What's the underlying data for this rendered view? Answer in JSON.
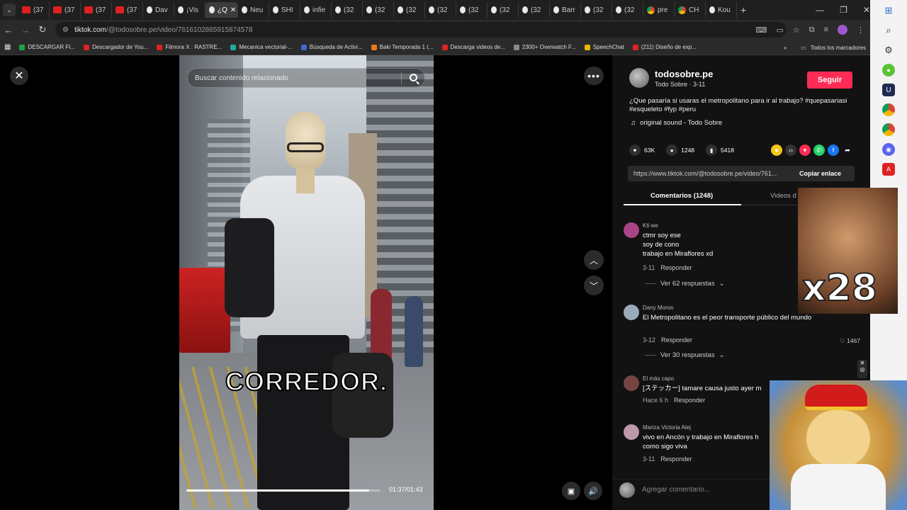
{
  "browser": {
    "tabs": [
      {
        "label": "(37",
        "icon": "youtube-icon"
      },
      {
        "label": "(37",
        "icon": "youtube-icon"
      },
      {
        "label": "(37",
        "icon": "youtube-icon"
      },
      {
        "label": "(37",
        "icon": "youtube-icon"
      },
      {
        "label": "Dav",
        "icon": "tiktok-icon"
      },
      {
        "label": "¡Vis",
        "icon": "tiktok-icon"
      },
      {
        "label": "¿Q",
        "icon": "tiktok-icon",
        "active": true
      },
      {
        "label": "Neu",
        "icon": "tiktok-icon"
      },
      {
        "label": "SHI",
        "icon": "tiktok-icon"
      },
      {
        "label": "infie",
        "icon": "tiktok-icon"
      },
      {
        "label": "(32",
        "icon": "tiktok-icon"
      },
      {
        "label": "(32",
        "icon": "tiktok-icon"
      },
      {
        "label": "(32",
        "icon": "tiktok-icon"
      },
      {
        "label": "(32",
        "icon": "tiktok-icon"
      },
      {
        "label": "(32",
        "icon": "tiktok-icon"
      },
      {
        "label": "(32",
        "icon": "tiktok-icon"
      },
      {
        "label": "(32",
        "icon": "tiktok-icon"
      },
      {
        "label": "Barr",
        "icon": "tiktok-icon"
      },
      {
        "label": "(32",
        "icon": "tiktok-icon"
      },
      {
        "label": "(32",
        "icon": "tiktok-icon"
      },
      {
        "label": "pre",
        "icon": "chrome-icon"
      },
      {
        "label": "CH",
        "icon": "chrome-icon"
      },
      {
        "label": "Kou",
        "icon": "tiktok-icon"
      }
    ],
    "url_host": "tiktok.com",
    "url_path": "/@todosobre.pe/video/7616102865915874578",
    "bookmarks": [
      {
        "label": "DESCARGAR FI...",
        "color": "#1aa34a"
      },
      {
        "label": "Descargador de You...",
        "color": "#d22"
      },
      {
        "label": "Filmora X : RASTRE...",
        "color": "#d22"
      },
      {
        "label": "Mecanica vectorial-...",
        "color": "#2a9"
      },
      {
        "label": "Búsqueda de Activi...",
        "color": "#46c"
      },
      {
        "label": "Baki Temporada 1 (...",
        "color": "#e87a1a"
      },
      {
        "label": "Descarga videos de...",
        "color": "#d22"
      },
      {
        "label": "2300+ Overwatch F...",
        "color": "#888"
      },
      {
        "label": "SpeechChat",
        "color": "#e6b800"
      },
      {
        "label": "(211) Diseño de exp...",
        "color": "#d22"
      }
    ],
    "all_bookmarks": "Todos los marcadores"
  },
  "video": {
    "search_placeholder": "Buscar contenido relacionado",
    "caption": "CORREDOR.",
    "time": "01:37/01:43",
    "progress": 0.94
  },
  "panel": {
    "author_name": "todosobre.pe",
    "author_sub": "Todo Sobre · 3-11",
    "follow": "Seguir",
    "description": "¿Que pasaría si usaras el metropolitano para ir al trabajo? #quepasariasi #esqueleto #fyp #peru",
    "sound": "original sound - Todo Sobre",
    "likes": "63K",
    "comments_count": "1248",
    "saves": "5418",
    "link": "https://www.tiktok.com/@todosobre.pe/video/761...",
    "copy_link": "Copiar enlace",
    "tab_comments": "Comentarios (1248)",
    "tab_videos": "Videos d",
    "comments": [
      {
        "user": "Kti we",
        "text": "ctmr soy ese\nsoy de cono\ntrabajo en Miraflores xd",
        "date": "3-11",
        "reply": "Responder",
        "replies": "Ver 62 respuestas",
        "likes": ""
      },
      {
        "user": "Dany Moron",
        "text": "El Metropolitano es el peor transporte público del mundo",
        "date": "3-12",
        "reply": "Responder",
        "replies": "Ver 30 respuestas",
        "likes": "1467"
      },
      {
        "user": "El más capo",
        "text": "[ステッカー] tamare causa justo ayer m",
        "date": "Hace 6 h",
        "reply": "Responder",
        "replies": "",
        "likes": ""
      },
      {
        "user": "Mariza Victoria Alej",
        "text": "vivo en Ancón y trabajo en Miraflores h\ncomo sigo viva",
        "date": "3-11",
        "reply": "Responder",
        "replies": "",
        "likes": ""
      }
    ],
    "add_comment_placeholder": "Agregar comentario..."
  },
  "overlay": {
    "multiplier": "x28"
  }
}
